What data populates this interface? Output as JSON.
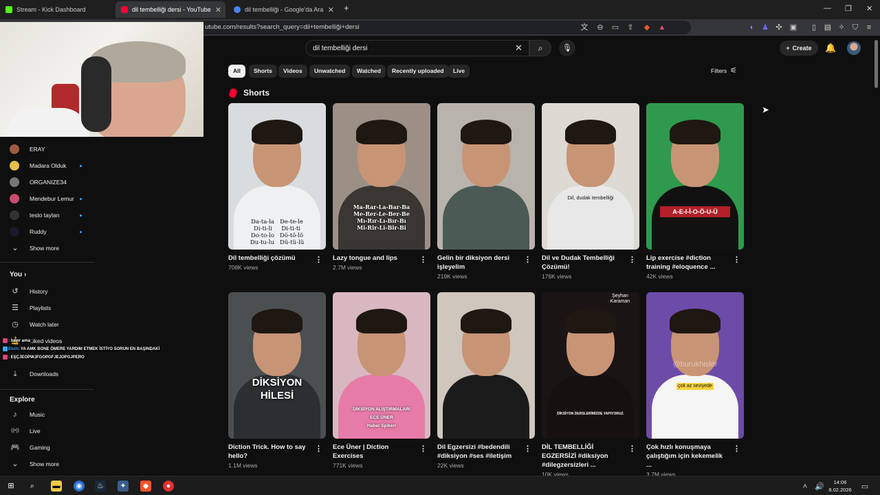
{
  "browser": {
    "tabs": [
      {
        "label": "Stream - Kick Dashboard",
        "color": "#53fc18"
      },
      {
        "label": "dil tembelliği dersi - YouTube",
        "color": "#ff0033"
      },
      {
        "label": "dil tembelliği - Google'da Ara",
        "color": "#4285f4"
      }
    ],
    "new_tab": "+",
    "url": "utube.com/results?search_query=dil+tembelliği+dersi"
  },
  "youtube": {
    "search_value": "dil tembelliği dersi",
    "create_label": "Create",
    "chips": [
      "All",
      "Shorts",
      "Videos",
      "Unwatched",
      "Watched",
      "Recently uploaded",
      "Live"
    ],
    "filters_label": "Filters",
    "shorts_heading": "Shorts"
  },
  "sidebar": {
    "subscriptions": [
      {
        "label": "ERAY",
        "color": "#a05a44",
        "live": false
      },
      {
        "label": "Madara Olduk",
        "color": "#e6c04a",
        "live": true
      },
      {
        "label": "ORGANIZE34",
        "color": "#777777",
        "live": false
      },
      {
        "label": "Mendebur Lemur",
        "color": "#c94b6d",
        "live": true
      },
      {
        "label": "testo taylan",
        "color": "#333333",
        "live": true
      },
      {
        "label": "Ruddy",
        "color": "#1a1a2e",
        "live": true
      }
    ],
    "show_more": "Show more",
    "you_heading": "You",
    "you_items": [
      {
        "label": "History",
        "icon": "history-icon"
      },
      {
        "label": "Playlists",
        "icon": "playlists-icon"
      },
      {
        "label": "Watch later",
        "icon": "clock-icon"
      },
      {
        "label": "Liked videos",
        "icon": "like-icon"
      },
      {
        "label": "Downloads",
        "icon": "download-icon"
      }
    ],
    "explore_heading": "Explore",
    "explore_items": [
      {
        "label": "Music",
        "icon": "music-icon"
      },
      {
        "label": "Live",
        "icon": "live-icon"
      },
      {
        "label": "Gaming",
        "icon": "gaming-icon"
      }
    ],
    "show_more_2": "Show more"
  },
  "chat": [
    {
      "user": "",
      "text": ": hayır ama",
      "color": "#e0457b"
    },
    {
      "user": "Elvin",
      "text": ": YA AMK BONE ÖMERE YARDIM ETMEK İSTİYO SORUN EN BAŞINDAKİ",
      "color": "#3ea6ff"
    },
    {
      "user": "",
      "text": ": EŞÇJEOPWJFGOPGFJEJOPGJPERO",
      "color": "#e0457b"
    }
  ],
  "shorts": [
    {
      "title": "Dil tembelliği çözümü",
      "views": "708K views",
      "bg": "#d8dcdf",
      "shirt": "#eef0f2",
      "overlay": "Da-ta-la   De-te-le\nDi-ti-li     Di-ti-ti\nDo-to-lo   Dö-tö-lö\nDu-tu-lu   Dü-tü-lü",
      "overlay_color": "#111"
    },
    {
      "title": "Lazy tongue and lips",
      "views": "2.7M views",
      "bg": "#9b8f86",
      "shirt": "#3a3632",
      "overlay": "Ma-Rar-La-Bar-Ba\nMe-Rer-Le-Ber-Be\nMı-Rır-Lı-Bır-Bı\nMi-Rir-Li-Bir-Bi",
      "overlay_color": "#ffffff"
    },
    {
      "title": "Gelin bir diksiyon dersi işleyelim",
      "views": "219K views",
      "bg": "#b9b3ad",
      "shirt": "#4b5a55",
      "overlay": "",
      "overlay_color": "#111"
    },
    {
      "title": "Dil ve Dudak Tembelliği Çözümü!",
      "views": "176K views",
      "bg": "#ddd9d3",
      "shirt": "#e8e8e8",
      "overlay": "Dil, dudak tembelliği",
      "overlay_color": "#111"
    },
    {
      "title": "Lip exercise #diction training #eloquence ...",
      "views": "42K views",
      "bg": "#2f9a4e",
      "shirt": "#111111",
      "overlay": "A-E-I-İ-O-Ö-U-Ü",
      "overlay_color": "#ffffff"
    },
    {
      "title": "Diction Trick. How to say hello?",
      "views": "1.1M views",
      "bg": "#4a4f52",
      "shirt": "#2c2f31",
      "overlay": "DİKSİYON\nHİLESİ",
      "overlay_color": "#ffffff"
    },
    {
      "title": "Ece Üner | Diction Exercises",
      "views": "771K views",
      "bg": "#d9b7c0",
      "shirt": "#e77ba8",
      "overlay": "DİKSİYON ALIŞTIRMALARI\nECE ÜNER\nHaber Spikeri",
      "overlay_color": "#ffffff"
    },
    {
      "title": "Dil Egzersizi #bedendili #diksiyon #ses #iletişim",
      "views": "22K views",
      "bg": "#cfc6bd",
      "shirt": "#1b1b1b",
      "overlay": "",
      "overlay_color": "#111"
    },
    {
      "title": "DİL TEMBELLİĞİ EGZERSİZİ #diksiyon #dilegzersizleri ...",
      "views": "10K views",
      "bg": "#1b1414",
      "shirt": "#161010",
      "overlay": "DİKSİYON DERSLERİMİZDE YAPIYORUZ.",
      "overlay_color": "#ffffff",
      "badge_text": "Şeyhan\nKaraman"
    },
    {
      "title": "Çok hızlı konuşmaya çalıştığım için kekemelik ...",
      "views": "3.7M views",
      "bg": "#6d4ba8",
      "shirt": "#f5f5f5",
      "overlay": "çok az seviyede",
      "overlay_color": "#111",
      "watermark": "@burukhisler"
    }
  ],
  "clock": {
    "time": "14:06",
    "date": "8.02.2026"
  }
}
